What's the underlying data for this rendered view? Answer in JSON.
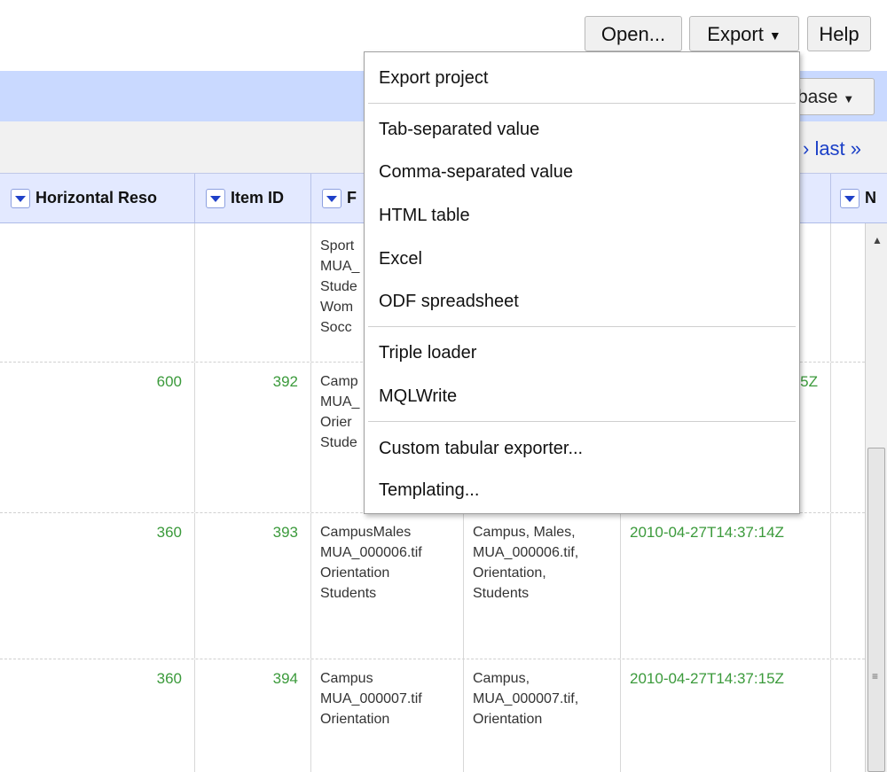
{
  "toolbar": {
    "open_label": "Open...",
    "export_label": "Export",
    "help_label": "Help"
  },
  "header": {
    "database_label": "base"
  },
  "pager": {
    "last_label": "› last »"
  },
  "columns": [
    {
      "label": "Horizontal Reso"
    },
    {
      "label": "Item ID"
    },
    {
      "label": "F"
    },
    {
      "label": ""
    },
    {
      "label": ""
    },
    {
      "label": "N"
    }
  ],
  "rows": [
    {
      "horizontal_res": "",
      "item_id": "",
      "col3": "Sport\nMUA_\nStude\nWom\nSocc",
      "col4": "",
      "date": ""
    },
    {
      "horizontal_res": "600",
      "item_id": "392",
      "col3": "Camp\nMUA_\nOrier\nStude",
      "col4": "",
      "date": "5Z"
    },
    {
      "horizontal_res": "360",
      "item_id": "393",
      "col3": "CampusMales\nMUA_000006.tif\nOrientation\nStudents",
      "col4": "Campus, Males,\nMUA_000006.tif,\nOrientation,\nStudents",
      "date": "2010-04-27T14:37:14Z"
    },
    {
      "horizontal_res": "360",
      "item_id": "394",
      "col3": "Campus\nMUA_000007.tif\nOrientation",
      "col4": "Campus,\nMUA_000007.tif,\nOrientation",
      "date": "2010-04-27T14:37:15Z"
    }
  ],
  "export_menu": {
    "items": [
      {
        "label": "Export project"
      },
      {
        "label": "Tab-separated value"
      },
      {
        "label": "Comma-separated value"
      },
      {
        "label": "HTML table"
      },
      {
        "label": "Excel"
      },
      {
        "label": "ODF spreadsheet"
      },
      {
        "label": "Triple loader"
      },
      {
        "label": "MQLWrite"
      },
      {
        "label": "Custom tabular exporter..."
      },
      {
        "label": "Templating..."
      }
    ]
  },
  "colors": {
    "header_band": "#c9d9ff",
    "column_header": "#e3e9ff",
    "number_green": "#3b9a3b",
    "link_blue": "#1a3fc7"
  },
  "icons": {
    "column_dropdown": "triangle-down-icon",
    "scroll_up": "arrow-up-icon",
    "scroll_grip": "grip-icon"
  }
}
